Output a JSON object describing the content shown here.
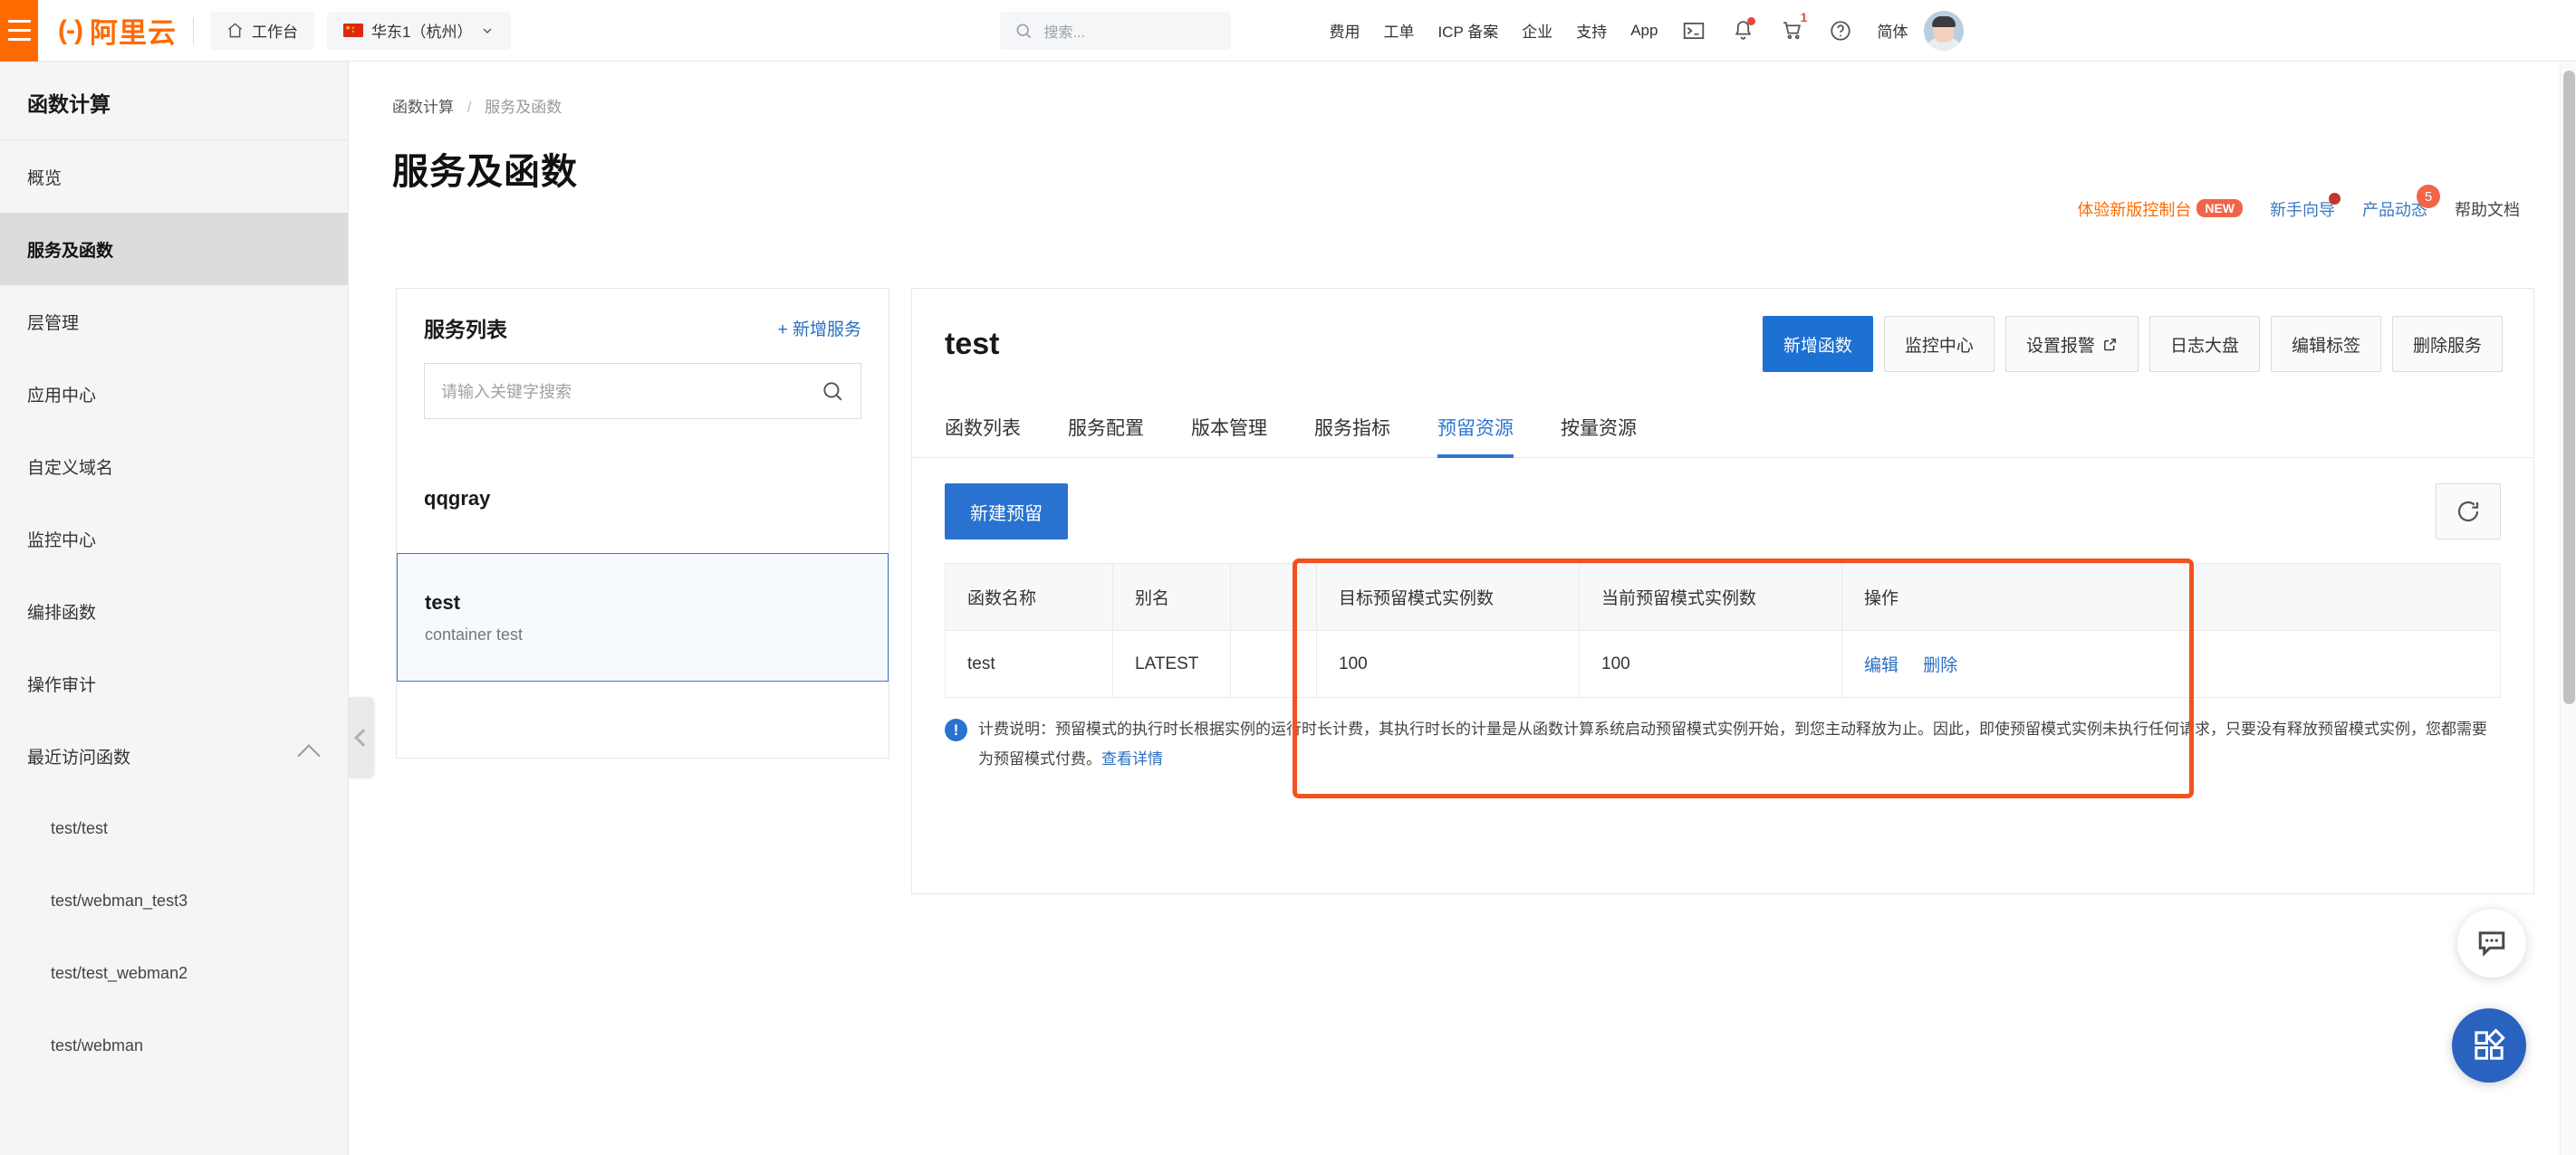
{
  "header": {
    "menu_icon": "hamburger-icon",
    "logo_text": "阿里云",
    "workbench": "工作台",
    "region": "华东1（杭州）",
    "search_placeholder": "搜索...",
    "nav": [
      {
        "label": "费用"
      },
      {
        "label": "工单"
      },
      {
        "label": "ICP 备案"
      },
      {
        "label": "企业"
      },
      {
        "label": "支持"
      },
      {
        "label": "App"
      }
    ],
    "lang": "简体",
    "cart_count": "1",
    "icons": [
      "console-icon",
      "bell-icon",
      "cart-icon",
      "help-icon"
    ]
  },
  "sidebar": {
    "title": "函数计算",
    "items": [
      {
        "label": "概览",
        "active": false
      },
      {
        "label": "服务及函数",
        "active": true
      },
      {
        "label": "层管理",
        "active": false
      },
      {
        "label": "应用中心",
        "active": false
      },
      {
        "label": "自定义域名",
        "active": false
      },
      {
        "label": "监控中心",
        "active": false
      },
      {
        "label": "编排函数",
        "active": false
      },
      {
        "label": "操作审计",
        "active": false
      }
    ],
    "group": {
      "label": "最近访问函数",
      "children": [
        {
          "label": "test/test"
        },
        {
          "label": "test/webman_test3"
        },
        {
          "label": "test/test_webman2"
        },
        {
          "label": "test/webman"
        }
      ]
    }
  },
  "breadcrumb": {
    "root": "函数计算",
    "current": "服务及函数"
  },
  "page": {
    "title": "服务及函数"
  },
  "top_links": {
    "new_console": "体验新版控制台",
    "new_badge": "NEW",
    "guide": "新手向导",
    "product_news": "产品动态",
    "product_news_count": "5",
    "help_doc": "帮助文档"
  },
  "service_list": {
    "title": "服务列表",
    "add_label": "+ 新增服务",
    "search_placeholder": "请输入关键字搜索",
    "items": [
      {
        "name": "qqgray",
        "desc": "",
        "selected": false
      },
      {
        "name": "test",
        "desc": "container test",
        "selected": true
      }
    ]
  },
  "detail": {
    "title": "test",
    "buttons": [
      {
        "label": "新增函数",
        "primary": true
      },
      {
        "label": "监控中心",
        "primary": false
      },
      {
        "label": "设置报警",
        "primary": false,
        "external": true
      },
      {
        "label": "日志大盘",
        "primary": false
      },
      {
        "label": "编辑标签",
        "primary": false
      },
      {
        "label": "删除服务",
        "primary": false
      }
    ],
    "tabs": [
      {
        "label": "函数列表",
        "active": false
      },
      {
        "label": "服务配置",
        "active": false
      },
      {
        "label": "版本管理",
        "active": false
      },
      {
        "label": "服务指标",
        "active": false
      },
      {
        "label": "预留资源",
        "active": true
      },
      {
        "label": "按量资源",
        "active": false
      }
    ],
    "toolbar": {
      "create_label": "新建预留",
      "refresh_icon": "refresh-icon"
    },
    "table": {
      "columns": [
        "函数名称",
        "别名",
        "",
        "目标预留模式实例数",
        "当前预留模式实例数",
        "操作"
      ],
      "rows": [
        {
          "function_name": "test",
          "alias": "LATEST",
          "gap": "",
          "target_instances": "100",
          "current_instances": "100",
          "actions": [
            "编辑",
            "删除"
          ]
        }
      ]
    },
    "notice": {
      "text": "计费说明：预留模式的执行时长根据实例的运行时长计费，其执行时长的计量是从函数计算系统启动预留模式实例开始，到您主动释放为止。因此，即使预留模式实例未执行任何请求，只要没有释放预留模式实例，您都需要为预留模式付费。",
      "link": "查看详情"
    }
  },
  "fab": {
    "chat_icon": "chat-bubble-icon",
    "apps_icon": "apps-grid-icon"
  },
  "colors": {
    "brand_orange": "#ff6a00",
    "primary_blue": "#2a72cf",
    "highlight_red": "#f4511e"
  }
}
